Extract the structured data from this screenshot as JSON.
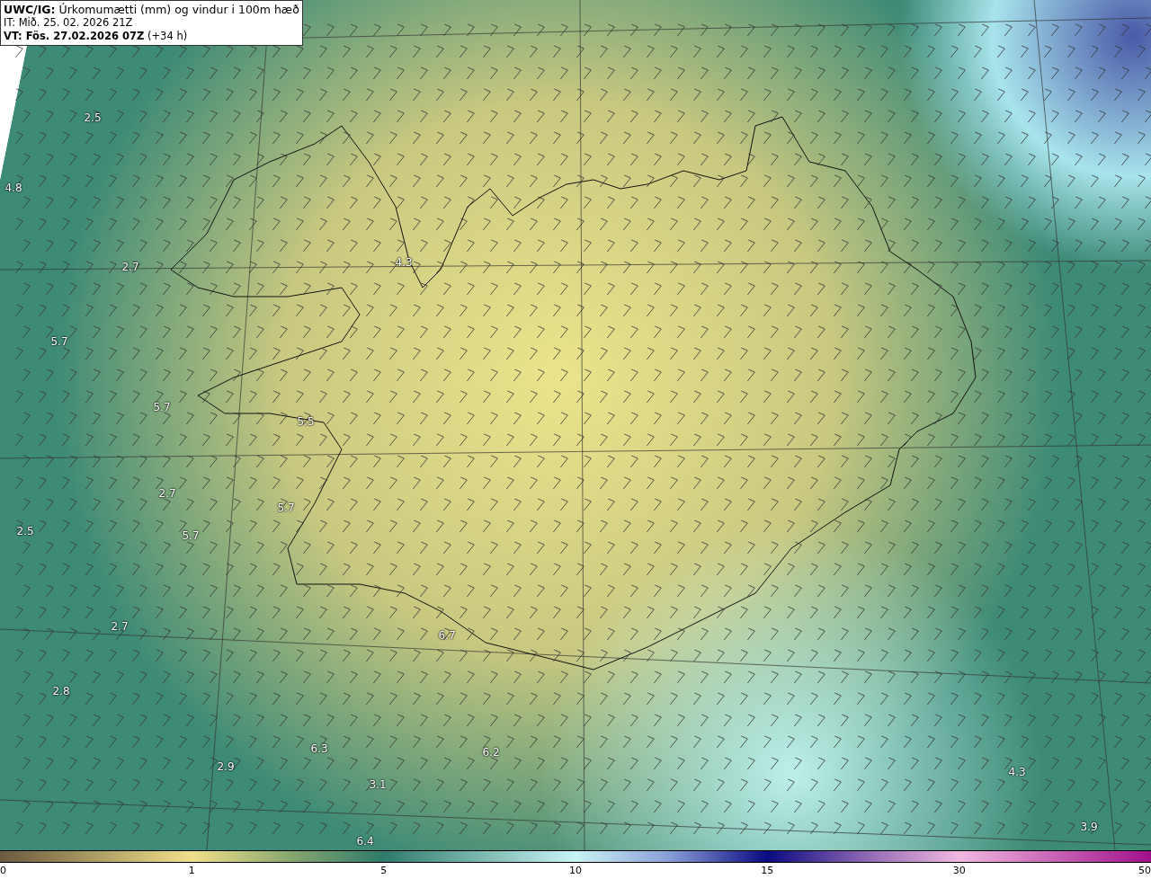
{
  "header": {
    "title": "**UWC/IG:** Úrkomumætti (mm) og vindur i 100m hæð",
    "issue_time": "IT: Mið. 25. 02. 2026 21Z",
    "valid_time": "**VT: Fös. 27.02.2026 07Z** (+34 h)"
  },
  "map": {
    "value_labels": [
      "2.5",
      "4.8",
      "2.7",
      "4.3",
      "5.7",
      "5.7",
      "5.5",
      "2.7",
      "5.7",
      "2.5",
      "5.7",
      "2.7",
      "6.7",
      "2.8",
      "6.3",
      "6.2",
      "2.9",
      "3.1",
      "4.3",
      "3.9",
      "6.4"
    ]
  },
  "colorbar": {
    "ticks": [
      "0",
      "1",
      "5",
      "10",
      "15",
      "30",
      "50"
    ]
  }
}
